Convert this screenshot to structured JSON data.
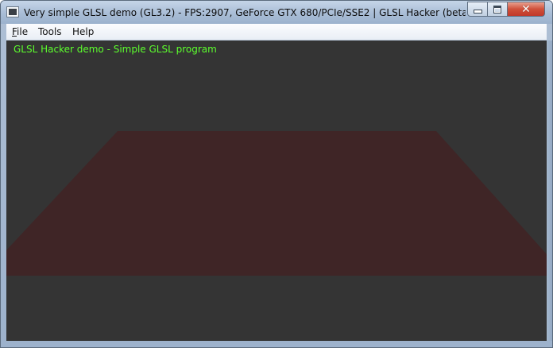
{
  "window": {
    "title": "Very simple GLSL demo (GL3.2) - FPS:2907, GeForce GTX 680/PCIe/SSE2 | GLSL Hacker (beta) (Windows...",
    "controls": {
      "minimize_icon": "minimize-icon",
      "maximize_icon": "maximize-icon",
      "close_icon": "close-icon",
      "close_glyph": "✕"
    }
  },
  "menu": {
    "file_first": "F",
    "file_rest": "ile",
    "tools": "Tools",
    "help": "Help"
  },
  "viewport": {
    "overlay_text": "GLSL Hacker demo - Simple GLSL program",
    "background_color": "#343434",
    "shape_color": "#3f2526",
    "overlay_color": "#5cff2d"
  }
}
